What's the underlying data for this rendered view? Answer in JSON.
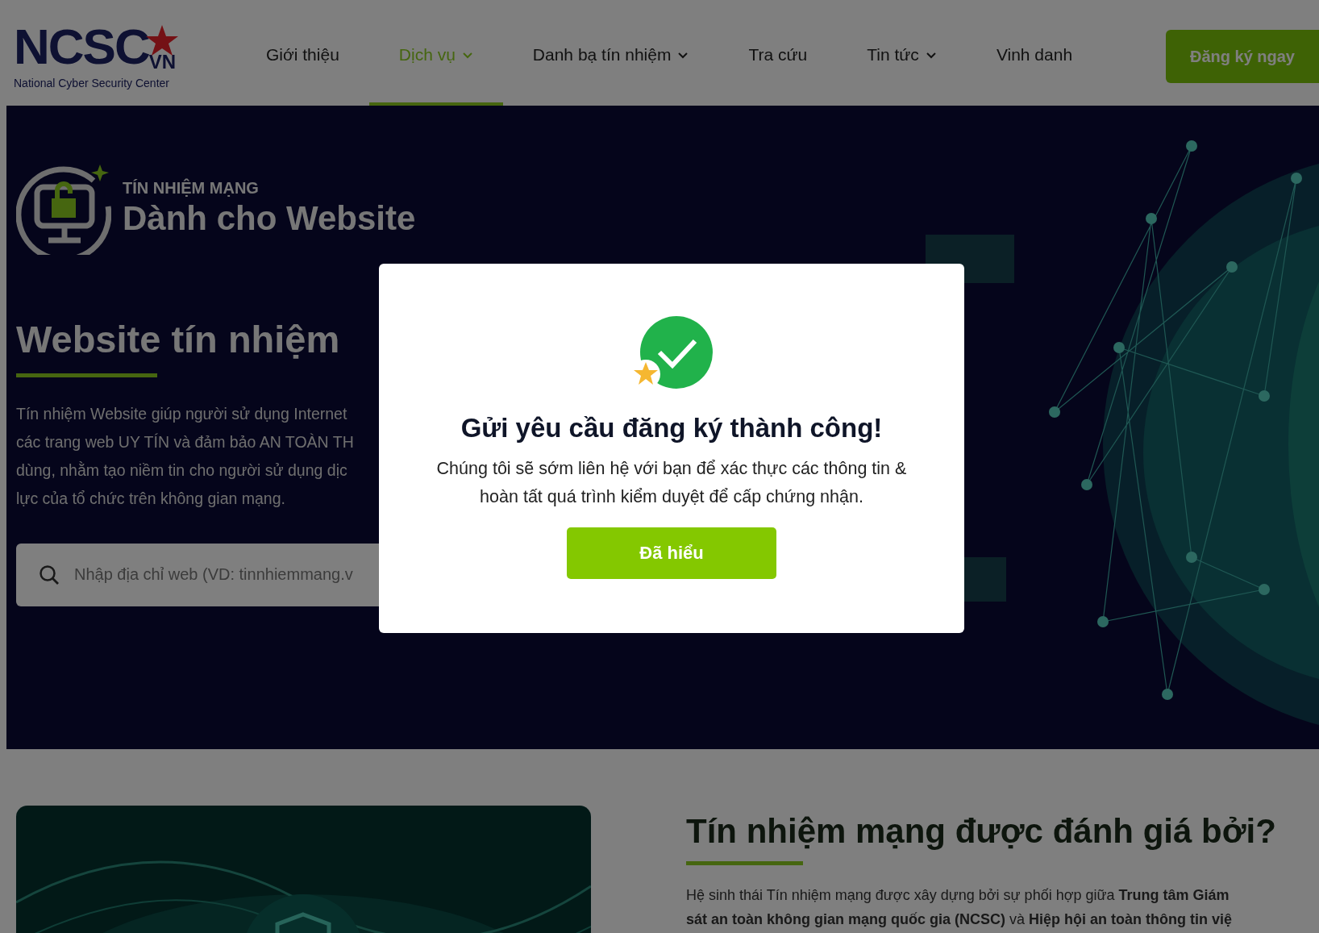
{
  "header": {
    "logo": {
      "mark": "NCSC",
      "suffix": "VN",
      "tagline": "National Cyber Security Center"
    },
    "nav": [
      {
        "label": "Giới thiệu",
        "selected": false,
        "has_dropdown": false
      },
      {
        "label": "Dịch vụ",
        "selected": true,
        "has_dropdown": true
      },
      {
        "label": "Danh bạ tín nhiệm",
        "selected": false,
        "has_dropdown": true
      },
      {
        "label": "Tra cứu",
        "selected": false,
        "has_dropdown": false
      },
      {
        "label": "Tin tức",
        "selected": false,
        "has_dropdown": true
      },
      {
        "label": "Vinh danh",
        "selected": false,
        "has_dropdown": false
      }
    ],
    "cta": "Đăng ký ngay"
  },
  "hero": {
    "eyebrow": "TÍN NHIỆM MẠNG",
    "subtitle": "Dành cho Website",
    "title": "Website tín nhiệm",
    "description_lines": [
      "Tín nhiệm Website giúp người sử dụng Internet",
      "các trang web UY TÍN và đảm bảo AN TOÀN TH",
      "dùng, nhằm tạo niềm tin cho người sử dụng dịc",
      "lực của tổ chức trên không gian mạng."
    ],
    "search": {
      "placeholder": "Nhập địa chỉ web (VD: tinnhiemmang.v"
    }
  },
  "modal": {
    "title": "Gửi yêu cầu đăng ký thành công!",
    "message": "Chúng tôi sẽ sớm liên hệ với bạn để xác thực các thông tin & hoàn tất quá trình kiểm duyệt để cấp chứng nhận.",
    "button": "Đã hiểu"
  },
  "section": {
    "title": "Tín nhiệm mạng được đánh giá bởi?",
    "paragraph_lines": [
      "Hệ sinh thái Tín nhiệm mạng được xây dựng bởi sự phối hợp giữa **Trung tâm Giám**",
      "**sát an toàn không gian mạng quốc gia (NCSC)** và **Hiệp hội an toàn thông tin việ**"
    ]
  }
}
